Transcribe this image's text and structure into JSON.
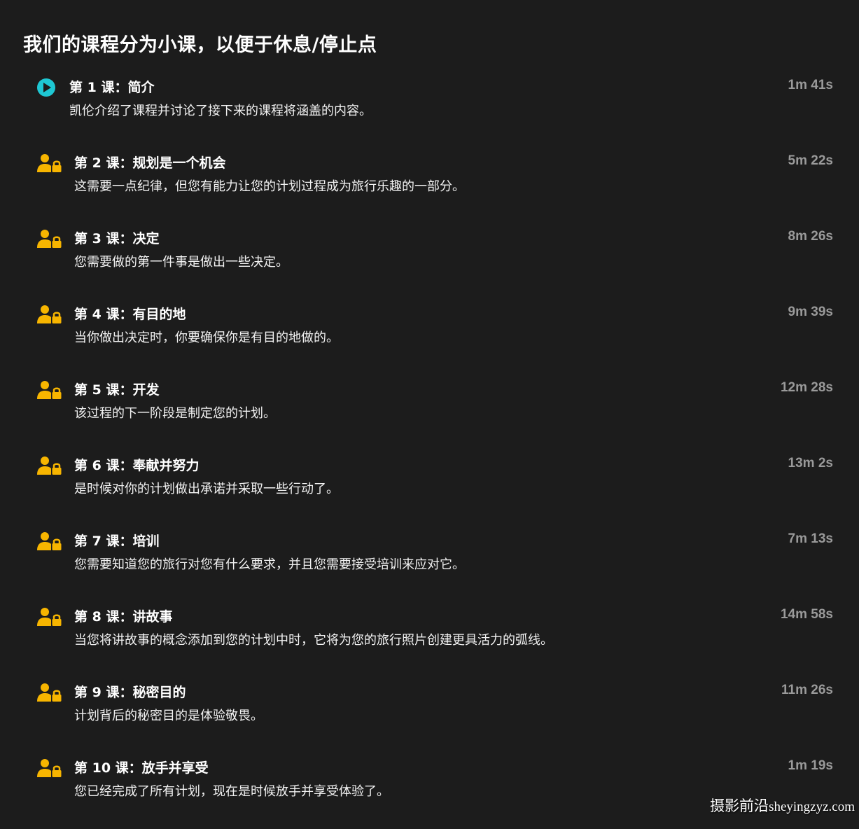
{
  "page": {
    "title": "我们的课程分为小课，以便于休息/停止点"
  },
  "colors": {
    "background": "#1c1c1c",
    "play_icon": "#1ec7d3",
    "lock_icon": "#f7b500",
    "duration_text": "#9a9a9a"
  },
  "lessons": [
    {
      "title": "第 1 课：简介",
      "description": "凯伦介绍了课程并讨论了接下来的课程将涵盖的内容。",
      "duration": "1m 41s",
      "icon": "play-icon"
    },
    {
      "title": "第 2 课：规划是一个机会",
      "description": "这需要一点纪律，但您有能力让您的计划过程成为旅行乐趣的一部分。",
      "duration": "5m 22s",
      "icon": "locked-user-icon"
    },
    {
      "title": "第 3 课：决定",
      "description": "您需要做的第一件事是做出一些决定。",
      "duration": "8m 26s",
      "icon": "locked-user-icon"
    },
    {
      "title": "第 4 课：有目的地",
      "description": "当你做出决定时，你要确保你是有目的地做的。",
      "duration": "9m 39s",
      "icon": "locked-user-icon"
    },
    {
      "title": "第 5 课：开发",
      "description": "该过程的下一阶段是制定您的计划。",
      "duration": "12m 28s",
      "icon": "locked-user-icon"
    },
    {
      "title": "第 6 课：奉献并努力",
      "description": "是时候对你的计划做出承诺并采取一些行动了。",
      "duration": "13m 2s",
      "icon": "locked-user-icon"
    },
    {
      "title": "第 7 课：培训",
      "description": "您需要知道您的旅行对您有什么要求，并且您需要接受培训来应对它。",
      "duration": "7m 13s",
      "icon": "locked-user-icon"
    },
    {
      "title": "第 8 课：讲故事",
      "description": "当您将讲故事的概念添加到您的计划中时，它将为您的旅行照片创建更具活力的弧线。",
      "duration": "14m 58s",
      "icon": "locked-user-icon"
    },
    {
      "title": "第 9 课：秘密目的",
      "description": "计划背后的秘密目的是体验敬畏。",
      "duration": "11m 26s",
      "icon": "locked-user-icon"
    },
    {
      "title": "第 10 课：放手并享受",
      "description": "您已经完成了所有计划，现在是时候放手并享受体验了。",
      "duration": "1m 19s",
      "icon": "locked-user-icon"
    }
  ],
  "watermark": {
    "text": "摄影前沿",
    "url": "sheyingzyz.com"
  }
}
